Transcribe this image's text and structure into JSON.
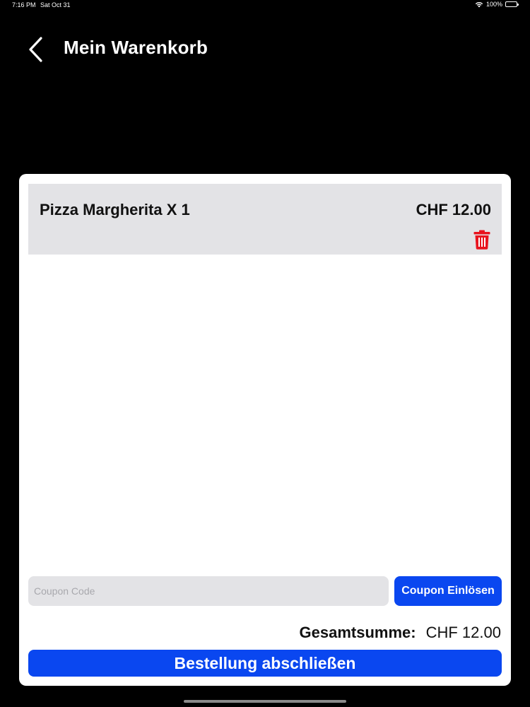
{
  "status_bar": {
    "time": "7:16 PM",
    "date": "Sat Oct 31",
    "battery": "100%",
    "icons": [
      "wifi-icon",
      "battery-icon"
    ]
  },
  "header": {
    "back_icon": "chevron-left-icon",
    "title": "Mein Warenkorb"
  },
  "cart": {
    "items": [
      {
        "name": "Pizza Margherita X 1",
        "price": "CHF 12.00",
        "delete_icon": "trash-icon"
      }
    ],
    "coupon": {
      "placeholder": "Coupon Code",
      "value": "",
      "button_label": "Coupon Einlösen"
    },
    "total": {
      "label": "Gesamtsumme:",
      "value": "CHF 12.00"
    },
    "checkout_label": "Bestellung abschließen"
  },
  "colors": {
    "background": "#000000",
    "card": "#ffffff",
    "item_background": "#e3e3e6",
    "accent": "#0a47f0",
    "delete": "#e8141e"
  }
}
